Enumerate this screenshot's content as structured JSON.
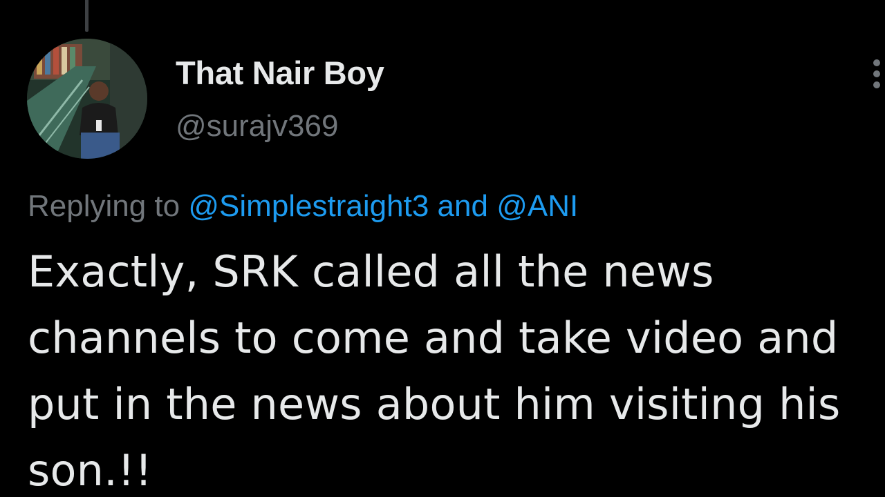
{
  "tweet": {
    "author": {
      "display_name": "That Nair Boy",
      "handle": "@surajv369",
      "avatar_icon": "profile-photo"
    },
    "more_icon": "more-vertical-icon",
    "reply_context": {
      "prefix": "Replying to",
      "mention_1": "@Simplestraight3",
      "conjunction": "and",
      "mention_2": "@ANI"
    },
    "text_lines": [
      "Exactly, SRK called all the news",
      "channels to come and take video and",
      "put in the news about him visiting his",
      "son.!!"
    ]
  },
  "colors": {
    "background": "#000000",
    "primary_text": "#e7e9ea",
    "secondary_text": "#71767b",
    "link": "#1d9bf0"
  }
}
